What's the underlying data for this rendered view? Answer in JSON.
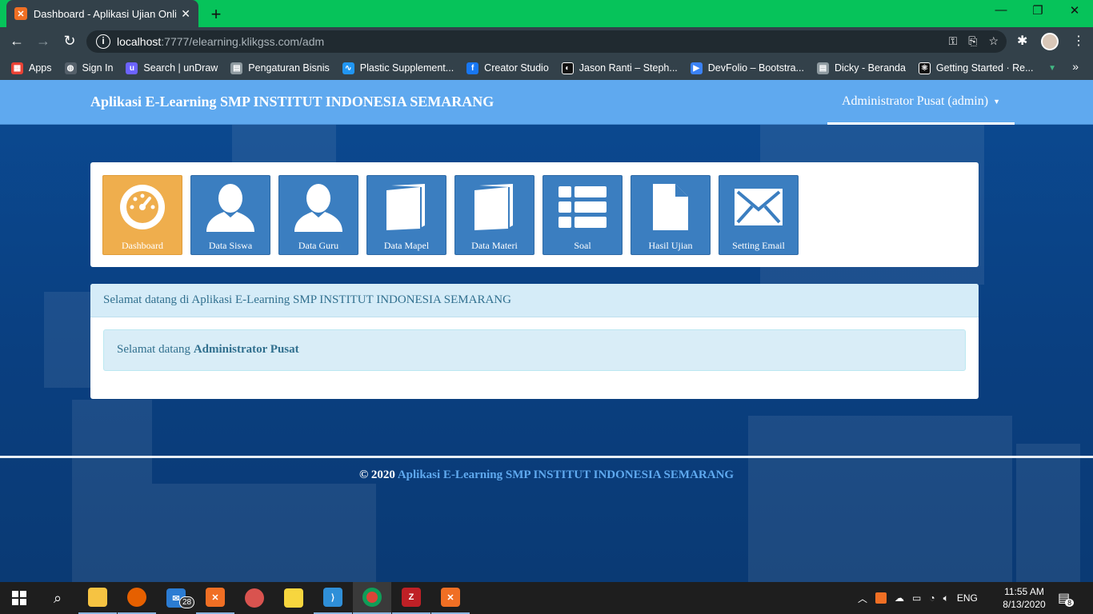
{
  "browser": {
    "tab_title": "Dashboard - Aplikasi Ujian Online",
    "tab_favicon": "xampp-icon",
    "url_host": "localhost",
    "url_rest": ":7777/elearning.klikgss.com/adm",
    "bookmarks": [
      {
        "label": "Apps",
        "icon": "apps-grid-icon",
        "color": "#e94235"
      },
      {
        "label": "Sign In",
        "icon": "globe-icon",
        "color": "#ffffff"
      },
      {
        "label": "Search | unDraw",
        "icon": "undraw-icon",
        "color": "#6c63ff"
      },
      {
        "label": "Pengaturan Bisnis",
        "icon": "page-icon",
        "color": "#8e9aa0"
      },
      {
        "label": "Plastic Supplement...",
        "icon": "wave-icon",
        "color": "#2196f3"
      },
      {
        "label": "Creator Studio",
        "icon": "facebook-icon",
        "color": "#1877f2"
      },
      {
        "label": "Jason Ranti – Steph...",
        "icon": "record-icon",
        "color": "#111111"
      },
      {
        "label": "DevFolio – Bootstra...",
        "icon": "devfolio-icon",
        "color": "#3b82f6"
      },
      {
        "label": "Dicky - Beranda",
        "icon": "page-icon",
        "color": "#8e9aa0"
      },
      {
        "label": "Getting Started · Re...",
        "icon": "react-icon",
        "color": "#111111"
      }
    ]
  },
  "app": {
    "brand": "Aplikasi E-Learning SMP INSTITUT INDONESIA SEMARANG",
    "user_menu": "Administrator Pusat (admin)",
    "tiles": [
      {
        "label": "Dashboard",
        "icon": "dashboard-gauge-icon"
      },
      {
        "label": "Data Siswa",
        "icon": "user-icon"
      },
      {
        "label": "Data Guru",
        "icon": "user-icon"
      },
      {
        "label": "Data Mapel",
        "icon": "book-icon"
      },
      {
        "label": "Data Materi",
        "icon": "book-icon"
      },
      {
        "label": "Soal",
        "icon": "list-icon"
      },
      {
        "label": "Hasil Ujian",
        "icon": "document-icon"
      },
      {
        "label": "Setting Email",
        "icon": "envelope-icon"
      }
    ],
    "welcome_heading": "Selamat datang di Aplikasi E-Learning SMP INSTITUT INDONESIA SEMARANG",
    "welcome_prefix": "Selamat datang ",
    "welcome_name": "Administrator Pusat",
    "footer_copyright": "© 2020 ",
    "footer_link": "Aplikasi E-Learning SMP INSTITUT INDONESIA SEMARANG"
  },
  "colors": {
    "navbar": "#5fa9ef",
    "tile": "#3b7ec0",
    "tile_active": "#efae4d",
    "titlebar": "#06c35a"
  },
  "taskbar": {
    "mail_badge": "28",
    "tray_lang": "ENG",
    "time": "11:55 AM",
    "date": "8/13/2020",
    "notifications": "8"
  }
}
